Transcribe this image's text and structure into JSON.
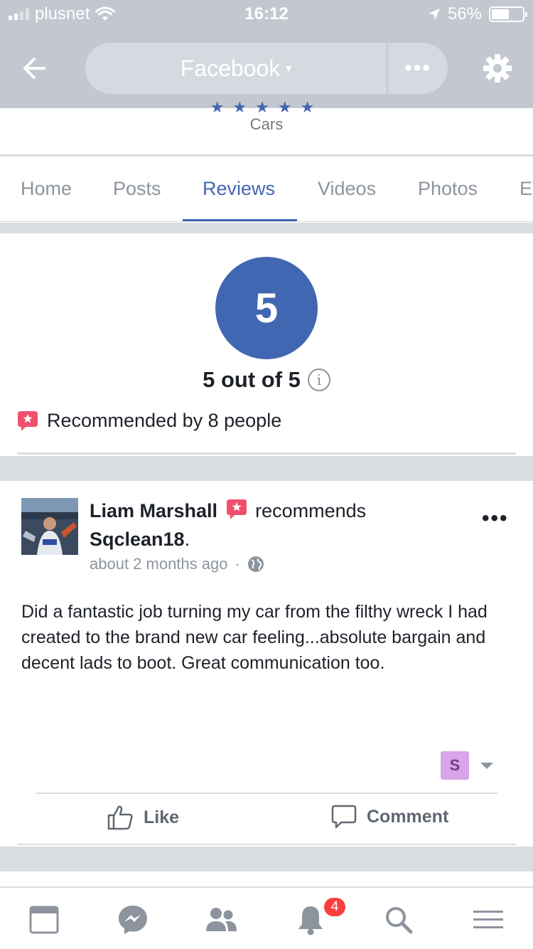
{
  "status_bar": {
    "carrier": "plusnet",
    "time": "16:12",
    "battery": "56%",
    "battery_level": 0.56
  },
  "nav": {
    "title": "Facebook",
    "title_caret": "▾",
    "more_label": "•••"
  },
  "page": {
    "category": "Cars"
  },
  "tabs": [
    {
      "label": "Home"
    },
    {
      "label": "Posts"
    },
    {
      "label": "Reviews",
      "active": true
    },
    {
      "label": "Videos"
    },
    {
      "label": "Photos"
    },
    {
      "label": "E"
    }
  ],
  "rating": {
    "value": "5",
    "summary": "5 out of 5",
    "info_glyph": "i",
    "recommended_text": "Recommended by 8 people"
  },
  "review": {
    "reviewer": "Liam Marshall",
    "verb": "recommends",
    "target": "Sqclean18",
    "punct": ".",
    "time": "about 2 months ago",
    "dot": "·",
    "body": "Did a fantastic job turning my car from the filthy wreck I had created to the brand new car feeling...absolute bargain and decent lads to boot. Great communication too.",
    "reaction_initial": "S",
    "more_label": "•••",
    "like_label": "Like",
    "comment_label": "Comment"
  },
  "bottom_nav": {
    "notifications_count": "4",
    "icons": [
      "news-feed-icon",
      "messenger-icon",
      "friends-icon",
      "notifications-icon",
      "search-icon",
      "menu-icon"
    ]
  },
  "colors": {
    "facebook_blue": "#4267b2",
    "recommend_red": "#f0506e",
    "notif_red": "#fa3e3e",
    "nav_gray": "#c3c8d0"
  }
}
